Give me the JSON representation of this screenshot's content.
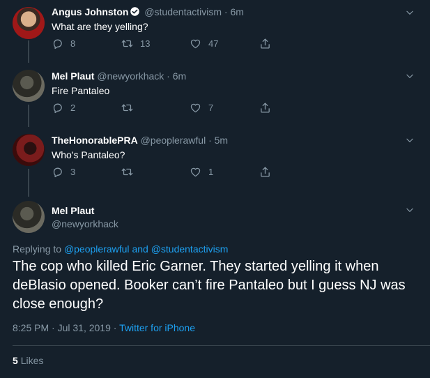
{
  "tweets": [
    {
      "name": "Angus Johnston",
      "handle": "@studentactivism",
      "time": "6m",
      "text": "What are they yelling?",
      "replies": "8",
      "retweets": "13",
      "likes": "47"
    },
    {
      "name": "Mel Plaut",
      "handle": "@newyorkhack",
      "time": "6m",
      "text": "Fire Pantaleo",
      "replies": "2",
      "retweets": "",
      "likes": "7"
    },
    {
      "name": "TheHonorablePRA",
      "handle": "@peoplerawful",
      "time": "5m",
      "text": "Who's Pantaleo?",
      "replies": "3",
      "retweets": "",
      "likes": "1"
    }
  ],
  "focus": {
    "name": "Mel Plaut",
    "handle": "@newyorkhack",
    "replying_prefix": "Replying to",
    "reply_user_1": "@peoplerawful",
    "reply_and": "and",
    "reply_user_2": "@studentactivism",
    "text": "The cop who killed Eric Garner. They started yelling it when deBlasio opened. Booker can’t fire Pantaleo but I guess NJ was close enough?",
    "timestamp": "8:25 PM · Jul 31, 2019 ·",
    "source": "Twitter for iPhone",
    "likes_count": "5",
    "likes_label": "Likes"
  },
  "separator": "·",
  "colors": {
    "background": "#15202b",
    "secondary_text": "#8899a6",
    "link": "#1da1f2",
    "line": "#38444d"
  },
  "icons": [
    "verified-badge-icon",
    "chevron-down-icon",
    "reply-icon",
    "retweet-icon",
    "like-icon",
    "share-icon"
  ]
}
